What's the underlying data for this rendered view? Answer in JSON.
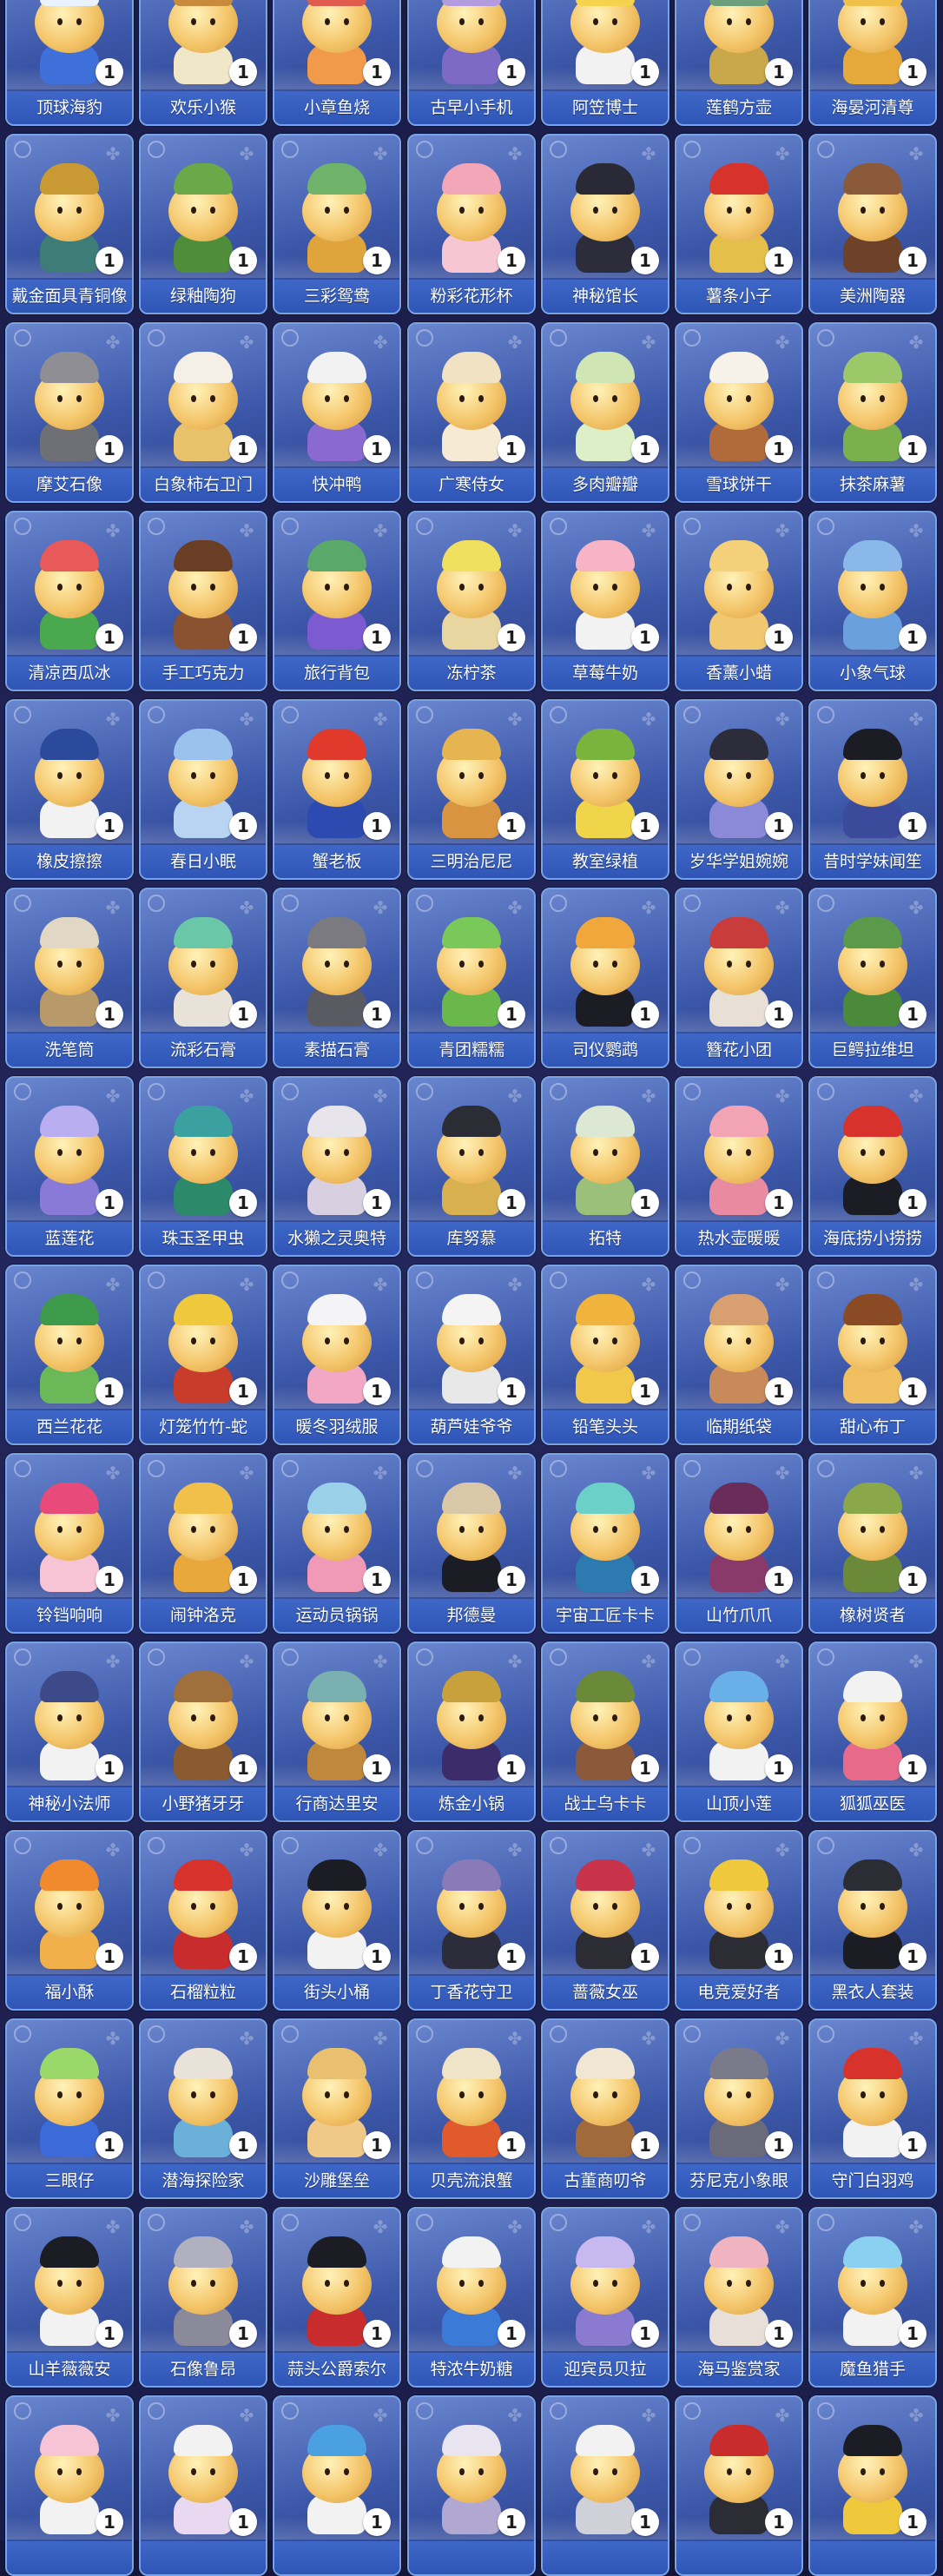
{
  "badge_value": "1",
  "colors": {
    "card_bg_top": "#6a86cf",
    "card_bg_bottom": "#2b3f88",
    "label_bar": "#2f56b6",
    "badge_bg": "#ffffff",
    "page_bg": "#1a1c48"
  },
  "cards": [
    {
      "name": "顶球海豹",
      "icon": "seal-figure-icon",
      "hat": "#eaf2ff",
      "outfit": "#3f6fd8"
    },
    {
      "name": "欢乐小猴",
      "icon": "monkey-figure-icon",
      "hat": "#c98a3c",
      "outfit": "#f0e6c8"
    },
    {
      "name": "小章鱼烧",
      "icon": "octopus-ball-figure-icon",
      "hat": "#e05a4e",
      "outfit": "#f09a4a"
    },
    {
      "name": "古早小手机",
      "icon": "retro-phone-figure-icon",
      "hat": "#b39be0",
      "outfit": "#7c6ac4"
    },
    {
      "name": "阿笠博士",
      "icon": "professor-figure-icon",
      "hat": "#f6d34c",
      "outfit": "#f2f2f2"
    },
    {
      "name": "莲鹤方壶",
      "icon": "bronze-pot-figure-icon",
      "hat": "#6b9e7a",
      "outfit": "#c8a84a"
    },
    {
      "name": "海晏河清尊",
      "icon": "vessel-figure-icon",
      "hat": "#f0c14a",
      "outfit": "#e4a93a"
    },
    {
      "name": "戴金面具青铜像",
      "icon": "bronze-mask-figure-icon",
      "hat": "#c99a34",
      "outfit": "#3e7c78"
    },
    {
      "name": "绿釉陶狗",
      "icon": "green-dog-figure-icon",
      "hat": "#6aa84a",
      "outfit": "#4f8d3a"
    },
    {
      "name": "三彩鸳鸯",
      "icon": "mandarin-duck-figure-icon",
      "hat": "#6fb36a",
      "outfit": "#e0a43c"
    },
    {
      "name": "粉彩花形杯",
      "icon": "flower-cup-figure-icon",
      "hat": "#f2a6b8",
      "outfit": "#f6c7d2"
    },
    {
      "name": "神秘馆长",
      "icon": "curator-figure-icon",
      "hat": "#2a2a36",
      "outfit": "#2c2c3a"
    },
    {
      "name": "薯条小子",
      "icon": "fries-figure-icon",
      "hat": "#d8322c",
      "outfit": "#e4c04a"
    },
    {
      "name": "美洲陶器",
      "icon": "pottery-figure-icon",
      "hat": "#8a5a3a",
      "outfit": "#6e4228"
    },
    {
      "name": "摩艾石像",
      "icon": "moai-figure-icon",
      "hat": "#8e8e94",
      "outfit": "#6f6f76"
    },
    {
      "name": "白象柿右卫门",
      "icon": "white-elephant-figure-icon",
      "hat": "#f4f0e8",
      "outfit": "#e8c26a"
    },
    {
      "name": "快冲鸭",
      "icon": "duck-figure-icon",
      "hat": "#f2f2f2",
      "outfit": "#8a6ad0"
    },
    {
      "name": "广寒侍女",
      "icon": "palace-maid-figure-icon",
      "hat": "#f2e2c4",
      "outfit": "#f6ead4"
    },
    {
      "name": "多肉瓣瓣",
      "icon": "succulent-figure-icon",
      "hat": "#cfe6b4",
      "outfit": "#dcefc6"
    },
    {
      "name": "雪球饼干",
      "icon": "snowball-cookie-figure-icon",
      "hat": "#f6f2ea",
      "outfit": "#b06a3c"
    },
    {
      "name": "抹茶麻薯",
      "icon": "matcha-mochi-figure-icon",
      "hat": "#9cc86a",
      "outfit": "#7ab04e"
    },
    {
      "name": "清凉西瓜冰",
      "icon": "watermelon-figure-icon",
      "hat": "#e85a5a",
      "outfit": "#4aa84e"
    },
    {
      "name": "手工巧克力",
      "icon": "chocolate-figure-icon",
      "hat": "#6a3e24",
      "outfit": "#8a5230"
    },
    {
      "name": "旅行背包",
      "icon": "backpack-figure-icon",
      "hat": "#5aa86a",
      "outfit": "#7c5ad0"
    },
    {
      "name": "冻柠茶",
      "icon": "lemon-tea-figure-icon",
      "hat": "#f0e060",
      "outfit": "#e8d6a0"
    },
    {
      "name": "草莓牛奶",
      "icon": "strawberry-milk-figure-icon",
      "hat": "#f6b4c6",
      "outfit": "#f2f2f2"
    },
    {
      "name": "香薰小蜡",
      "icon": "candle-figure-icon",
      "hat": "#f4d07a",
      "outfit": "#f0c870"
    },
    {
      "name": "小象气球",
      "icon": "elephant-balloon-figure-icon",
      "hat": "#8ab8e8",
      "outfit": "#6aa0dc"
    },
    {
      "name": "橡皮擦擦",
      "icon": "eraser-figure-icon",
      "hat": "#2c4a9c",
      "outfit": "#f2f2f2"
    },
    {
      "name": "春日小眠",
      "icon": "sleepy-figure-icon",
      "hat": "#9ac2ec",
      "outfit": "#b8d4f2"
    },
    {
      "name": "蟹老板",
      "icon": "crab-figure-icon",
      "hat": "#e03a2c",
      "outfit": "#2c4ab0"
    },
    {
      "name": "三明治尼尼",
      "icon": "sandwich-figure-icon",
      "hat": "#e6b450",
      "outfit": "#d89440"
    },
    {
      "name": "教室绿植",
      "icon": "plant-figure-icon",
      "hat": "#7ab43c",
      "outfit": "#f0d44a"
    },
    {
      "name": "岁华学姐婉婉",
      "icon": "student-girl-figure-icon",
      "hat": "#2c2c3a",
      "outfit": "#8a8ad8"
    },
    {
      "name": "昔时学妹闻笙",
      "icon": "student-girl2-figure-icon",
      "hat": "#1c1c24",
      "outfit": "#3c4a9c"
    },
    {
      "name": "洗笔筒",
      "icon": "brush-washer-figure-icon",
      "hat": "#e0d8c4",
      "outfit": "#b89a6a"
    },
    {
      "name": "流彩石膏",
      "icon": "plaster-figure-icon",
      "hat": "#6ac8a8",
      "outfit": "#e8e2d8"
    },
    {
      "name": "素描石膏",
      "icon": "sketch-plaster-figure-icon",
      "hat": "#7a7a80",
      "outfit": "#5a5a62"
    },
    {
      "name": "青团糯糯",
      "icon": "green-dumpling-figure-icon",
      "hat": "#7ac85a",
      "outfit": "#6ab84c"
    },
    {
      "name": "司仪鹦鹉",
      "icon": "parrot-figure-icon",
      "hat": "#f0a83c",
      "outfit": "#1c1c24"
    },
    {
      "name": "簪花小团",
      "icon": "hairpin-figure-icon",
      "hat": "#c83c3c",
      "outfit": "#e8e0d4"
    },
    {
      "name": "巨鳄拉维坦",
      "icon": "crocodile-figure-icon",
      "hat": "#5a9a4a",
      "outfit": "#4a8a3a"
    },
    {
      "name": "蓝莲花",
      "icon": "blue-lotus-figure-icon",
      "hat": "#b8aef0",
      "outfit": "#8a7ad8"
    },
    {
      "name": "珠玉圣甲虫",
      "icon": "scarab-figure-icon",
      "hat": "#3aa0a0",
      "outfit": "#2c8a6a"
    },
    {
      "name": "水獭之灵奥特",
      "icon": "otter-figure-icon",
      "hat": "#e8e4ec",
      "outfit": "#d8d0e0"
    },
    {
      "name": "库努慕",
      "icon": "khnum-figure-icon",
      "hat": "#2c2c34",
      "outfit": "#d8b050"
    },
    {
      "name": "拓特",
      "icon": "thoth-figure-icon",
      "hat": "#dce8d4",
      "outfit": "#9ac07a"
    },
    {
      "name": "热水壶暖暖",
      "icon": "kettle-figure-icon",
      "hat": "#f2a4b4",
      "outfit": "#e88aa0"
    },
    {
      "name": "海底捞小捞捞",
      "icon": "panda-figure-icon",
      "hat": "#d8322c",
      "outfit": "#1c1c24"
    },
    {
      "name": "西兰花花",
      "icon": "broccoli-figure-icon",
      "hat": "#3c9a4a",
      "outfit": "#6ab858"
    },
    {
      "name": "灯笼竹竹-蛇",
      "icon": "lantern-snake-figure-icon",
      "hat": "#f0c83c",
      "outfit": "#c83c2c"
    },
    {
      "name": "暖冬羽绒服",
      "icon": "down-jacket-figure-icon",
      "hat": "#f4f4f6",
      "outfit": "#f2a8c4"
    },
    {
      "name": "葫芦娃爷爷",
      "icon": "grandpa-figure-icon",
      "hat": "#f4f4f4",
      "outfit": "#e8e8e8"
    },
    {
      "name": "铅笔头头",
      "icon": "pencil-figure-icon",
      "hat": "#f0b43c",
      "outfit": "#f2c84a"
    },
    {
      "name": "临期纸袋",
      "icon": "paper-bag-figure-icon",
      "hat": "#d8a070",
      "outfit": "#c88a5a"
    },
    {
      "name": "甜心布丁",
      "icon": "pudding-figure-icon",
      "hat": "#8a4a24",
      "outfit": "#f0c060"
    },
    {
      "name": "铃铛响响",
      "icon": "bell-figure-icon",
      "hat": "#e84a7a",
      "outfit": "#f6c4d4"
    },
    {
      "name": "闹钟洛克",
      "icon": "alarm-clock-figure-icon",
      "hat": "#f0c04a",
      "outfit": "#e8a83c"
    },
    {
      "name": "运动员锅锅",
      "icon": "athlete-figure-icon",
      "hat": "#9ad0e8",
      "outfit": "#f09ab8"
    },
    {
      "name": "邦德曼",
      "icon": "bondman-figure-icon",
      "hat": "#d8c8a8",
      "outfit": "#1c1c24"
    },
    {
      "name": "宇宙工匠卡卡",
      "icon": "space-craftsman-figure-icon",
      "hat": "#6ad0c8",
      "outfit": "#2c7ab0"
    },
    {
      "name": "山竹爪爪",
      "icon": "mangosteen-figure-icon",
      "hat": "#6a2c5a",
      "outfit": "#8a3a6a"
    },
    {
      "name": "橡树贤者",
      "icon": "oak-sage-figure-icon",
      "hat": "#8aa84a",
      "outfit": "#6a8a3a"
    },
    {
      "name": "神秘小法师",
      "icon": "wizard-figure-icon",
      "hat": "#3c4a8a",
      "outfit": "#f2f2f2"
    },
    {
      "name": "小野猪牙牙",
      "icon": "boar-figure-icon",
      "hat": "#a0703c",
      "outfit": "#8a5a30"
    },
    {
      "name": "行商达里安",
      "icon": "merchant-figure-icon",
      "hat": "#7ab0b0",
      "outfit": "#c0883c"
    },
    {
      "name": "炼金小锅",
      "icon": "alchemy-pot-figure-icon",
      "hat": "#c8a03c",
      "outfit": "#3c2c6a"
    },
    {
      "name": "战士乌卡卡",
      "icon": "warrior-figure-icon",
      "hat": "#6a8a3a",
      "outfit": "#8a5a3a"
    },
    {
      "name": "山顶小莲",
      "icon": "mountain-lotus-figure-icon",
      "hat": "#6ab0e8",
      "outfit": "#f2f2f2"
    },
    {
      "name": "狐狐巫医",
      "icon": "fox-shaman-figure-icon",
      "hat": "#f2f2f2",
      "outfit": "#e86a8a"
    },
    {
      "name": "福小酥",
      "icon": "fu-pastry-figure-icon",
      "hat": "#f08a2c",
      "outfit": "#f2b04a"
    },
    {
      "name": "石榴粒粒",
      "icon": "pomegranate-figure-icon",
      "hat": "#d8322c",
      "outfit": "#c82c2c"
    },
    {
      "name": "街头小桶",
      "icon": "bucket-figure-icon",
      "hat": "#1c1c24",
      "outfit": "#f2f2f2"
    },
    {
      "name": "丁香花守卫",
      "icon": "lilac-guard-figure-icon",
      "hat": "#8a7ab8",
      "outfit": "#2c2c3a"
    },
    {
      "name": "蔷薇女巫",
      "icon": "rose-witch-figure-icon",
      "hat": "#c8324a",
      "outfit": "#2c2c34"
    },
    {
      "name": "电竞爱好者",
      "icon": "gamer-figure-icon",
      "hat": "#f0c83c",
      "outfit": "#2c2c34"
    },
    {
      "name": "黑衣人套装",
      "icon": "man-in-black-figure-icon",
      "hat": "#2c2c34",
      "outfit": "#1c1c24"
    },
    {
      "name": "三眼仔",
      "icon": "alien-figure-icon",
      "hat": "#9ad86a",
      "outfit": "#3c6ad8"
    },
    {
      "name": "潜海探险家",
      "icon": "diver-figure-icon",
      "hat": "#e8e2d8",
      "outfit": "#6ab0d8"
    },
    {
      "name": "沙雕堡垒",
      "icon": "sandcastle-figure-icon",
      "hat": "#e8c070",
      "outfit": "#f0c888"
    },
    {
      "name": "贝壳流浪蟹",
      "icon": "shell-crab-figure-icon",
      "hat": "#f0e4c8",
      "outfit": "#e05a2c"
    },
    {
      "name": "古董商叨爷",
      "icon": "antique-dealer-figure-icon",
      "hat": "#f0e6d4",
      "outfit": "#a06a3c"
    },
    {
      "name": "芬尼克小象眼",
      "icon": "elephant-eye-figure-icon",
      "hat": "#7a7a8a",
      "outfit": "#6a6a7a"
    },
    {
      "name": "守门白羽鸡",
      "icon": "rooster-figure-icon",
      "hat": "#d8322c",
      "outfit": "#f2f2f2"
    },
    {
      "name": "山羊薇薇安",
      "icon": "goat-figure-icon",
      "hat": "#1c1c24",
      "outfit": "#f2f2f2"
    },
    {
      "name": "石像鲁昂",
      "icon": "gargoyle-figure-icon",
      "hat": "#b0b0c0",
      "outfit": "#8a8a9a"
    },
    {
      "name": "蒜头公爵索尔",
      "icon": "garlic-duke-figure-icon",
      "hat": "#1c1c24",
      "outfit": "#c82c2c"
    },
    {
      "name": "特浓牛奶糖",
      "icon": "milk-candy-figure-icon",
      "hat": "#f2f2f2",
      "outfit": "#3c7ad8"
    },
    {
      "name": "迎宾员贝拉",
      "icon": "greeter-figure-icon",
      "hat": "#c8b8f0",
      "outfit": "#8a7ad0"
    },
    {
      "name": "海马鉴赏家",
      "icon": "seahorse-figure-icon",
      "hat": "#f0b4c0",
      "outfit": "#e8e0d8"
    },
    {
      "name": "魔鱼猎手",
      "icon": "fish-hunter-figure-icon",
      "hat": "#8ad0f0",
      "outfit": "#f2f2f2"
    },
    {
      "name": "",
      "icon": "figure-icon",
      "hat": "#f6c4d4",
      "outfit": "#f2f2f2"
    },
    {
      "name": "",
      "icon": "figure-icon",
      "hat": "#f2f2f2",
      "outfit": "#e8d8f0"
    },
    {
      "name": "",
      "icon": "figure-icon",
      "hat": "#4aa0e0",
      "outfit": "#f2f2f2"
    },
    {
      "name": "",
      "icon": "figure-icon",
      "hat": "#e8e4f0",
      "outfit": "#b0a8d0"
    },
    {
      "name": "",
      "icon": "figure-icon",
      "hat": "#f2f2f2",
      "outfit": "#d0d0d8"
    },
    {
      "name": "",
      "icon": "figure-icon",
      "hat": "#c82c2c",
      "outfit": "#2c2c34"
    },
    {
      "name": "",
      "icon": "figure-icon",
      "hat": "#1c1c24",
      "outfit": "#f0c83c"
    }
  ]
}
